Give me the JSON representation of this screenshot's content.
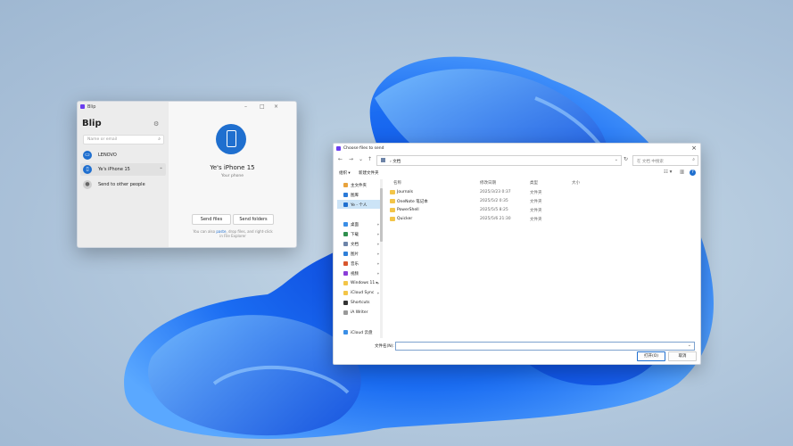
{
  "blip": {
    "window_title": "Blip",
    "app_title": "Blip",
    "search_placeholder": "Name or email",
    "devices": [
      {
        "label": "LENOVO"
      },
      {
        "label": "Ye's iPhone 15"
      },
      {
        "label": "Send to other people"
      }
    ],
    "device_name": "Ye's iPhone 15",
    "device_sub": "Your phone",
    "send_files": "Send files",
    "send_folders": "Send folders",
    "hint_pre": "You can also",
    "hint_link": "paste",
    "hint_mid": ", drop files, and right-click",
    "hint_post": "in File Explorer",
    "controls": {
      "min": "–",
      "max": "□",
      "close": "×"
    }
  },
  "dialog": {
    "title": "Choose files to send",
    "path": "文档",
    "path_sep": "›",
    "search_placeholder": "在 文档 中搜索",
    "organize": "组织 ▾",
    "new_folder": "新建文件夹",
    "columns": {
      "name": "名称",
      "date": "修改日期",
      "type": "类型",
      "size": "大小"
    },
    "nav_items": [
      {
        "label": "主文件夹",
        "color": "#e8a33d"
      },
      {
        "label": "图库",
        "color": "#2a7ad8"
      },
      {
        "label": "Ye - 个人",
        "color": "#1f6fcf"
      },
      {
        "label": "桌面",
        "color": "#3a8ee6"
      },
      {
        "label": "下载",
        "color": "#2f8f4e"
      },
      {
        "label": "文档",
        "color": "#6d84a8"
      },
      {
        "label": "图片",
        "color": "#2d7fd8"
      },
      {
        "label": "音乐",
        "color": "#d8562d"
      },
      {
        "label": "视频",
        "color": "#8a3dd8"
      },
      {
        "label": "Windows 11 ▸",
        "color": "#f3c548"
      },
      {
        "label": "iCloud Sync",
        "color": "#f3c548"
      },
      {
        "label": "Shortcuts",
        "color": "#333333"
      },
      {
        "label": "iA Writer",
        "color": "#999999"
      },
      {
        "label": "iCloud 云盘",
        "color": "#3a8ee6"
      }
    ],
    "files": [
      {
        "name": "Journals",
        "date": "2025/3/23 0:37",
        "type": "文件夹"
      },
      {
        "name": "OneNote 笔记本",
        "date": "2025/5/2 0:35",
        "type": "文件夹"
      },
      {
        "name": "PowerShell",
        "date": "2025/5/5 8:25",
        "type": "文件夹"
      },
      {
        "name": "Quicker",
        "date": "2025/5/6 21:30",
        "type": "文件夹"
      }
    ],
    "filename_label": "文件名(N):",
    "open_button": "打开(O)",
    "cancel_button": "取消"
  }
}
